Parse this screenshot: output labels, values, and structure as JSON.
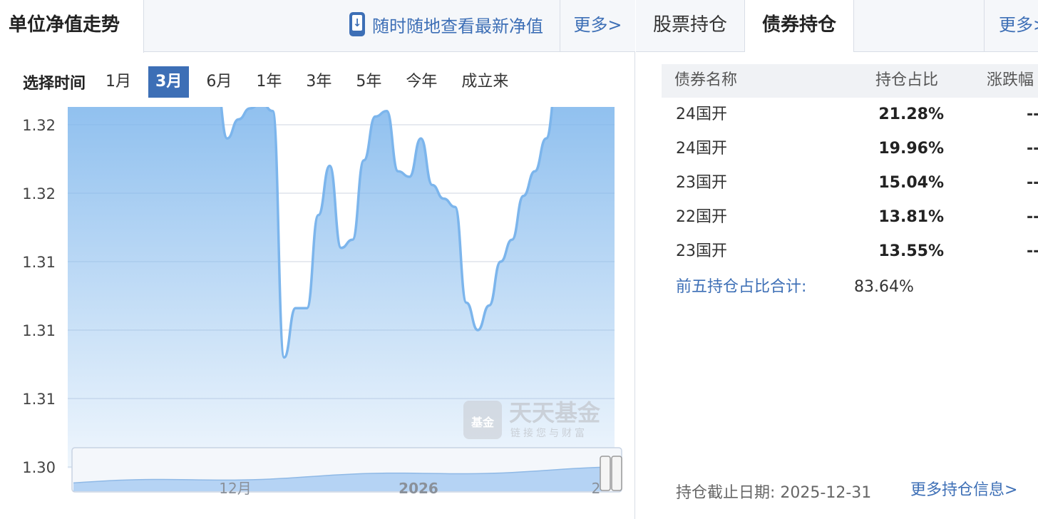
{
  "left_panel": {
    "title": "单位净值走势",
    "mobile_link": "随时随地查看最新净值",
    "more_link": "更多>",
    "range_label": "选择时间",
    "ranges": [
      "1月",
      "3月",
      "6月",
      "1年",
      "3年",
      "5年",
      "今年",
      "成立来"
    ],
    "active_range": "3月"
  },
  "watermark": {
    "brand": "天天基金",
    "slogan": "链接您与财富",
    "logo_text": "基金"
  },
  "chart_data": {
    "type": "area",
    "y_tick_labels": [
      "1.32",
      "1.32",
      "1.31",
      "1.31",
      "1.31",
      "1.30"
    ],
    "ylim": [
      1.3,
      1.3125
    ],
    "grid": true,
    "color": "#7cb5ec",
    "values": [
      1.315,
      1.3147,
      1.315,
      1.3137,
      1.3137,
      1.3138,
      1.3144,
      1.3143,
      1.3146,
      1.3151,
      1.3148,
      1.3149,
      1.3148,
      1.3142,
      1.312,
      1.3127,
      1.3131,
      1.3133,
      1.313,
      1.304,
      1.3058,
      1.3058,
      1.3092,
      1.311,
      1.308,
      1.3083,
      1.3112,
      1.3128,
      1.313,
      1.3108,
      1.3106,
      1.312,
      1.3103,
      1.3098,
      1.3095,
      1.306,
      1.305,
      1.3059,
      1.3075,
      1.3083,
      1.3099,
      1.3108,
      1.312,
      1.3142,
      1.3151,
      1.3151,
      1.3145,
      1.3149,
      1.3151
    ],
    "navigator": {
      "labels": [
        "12月",
        "2026",
        "2"
      ]
    }
  },
  "right_panel": {
    "tabs": [
      "股票持仓",
      "债券持仓"
    ],
    "active_tab": "债券持仓",
    "more_link": "更多>",
    "headers": [
      "债券名称",
      "持仓占比",
      "涨跌幅"
    ],
    "rows": [
      {
        "name": "24国开",
        "ratio": "21.28%",
        "change": "--"
      },
      {
        "name": "24国开",
        "ratio": "19.96%",
        "change": "--"
      },
      {
        "name": "23国开",
        "ratio": "15.04%",
        "change": "--"
      },
      {
        "name": "22国开",
        "ratio": "13.81%",
        "change": "--"
      },
      {
        "name": "23国开",
        "ratio": "13.55%",
        "change": "--"
      }
    ],
    "summary_label": "前五持仓占比合计:",
    "summary_value": "83.64%",
    "date_label": "持仓截止日期: 2025-12-31",
    "more_holdings_link": "更多持仓信息>"
  }
}
